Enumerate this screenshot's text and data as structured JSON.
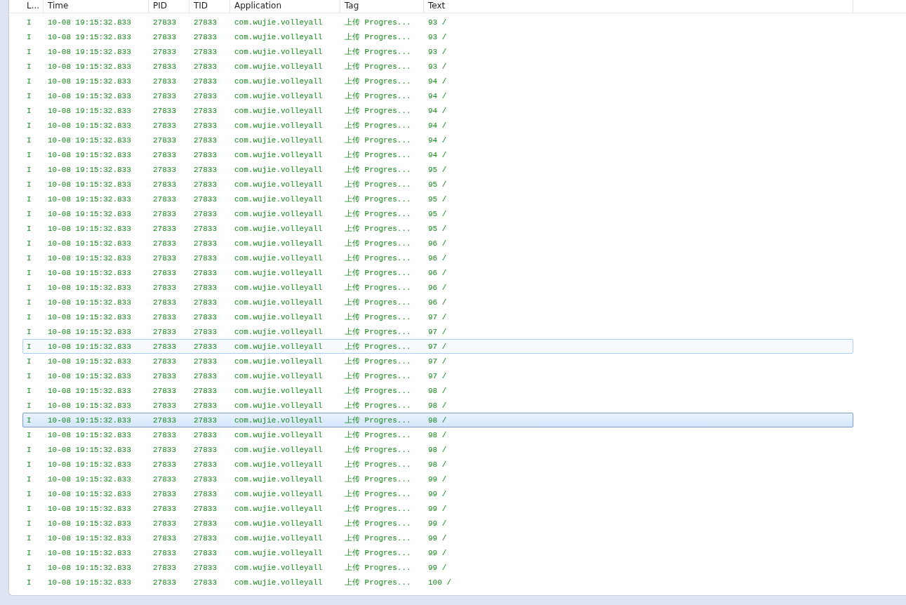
{
  "columns": [
    {
      "label": "L..."
    },
    {
      "label": "Time"
    },
    {
      "label": "PID"
    },
    {
      "label": "TID"
    },
    {
      "label": "Application"
    },
    {
      "label": "Tag"
    },
    {
      "label": "Text"
    }
  ],
  "rows": [
    {
      "cells": [
        "I",
        "10-08 19:15:32.833",
        "27833",
        "27833",
        "com.wujie.volleyall",
        "上传 Progres...",
        "93 /"
      ],
      "selected": false,
      "hovered": false
    },
    {
      "cells": [
        "I",
        "10-08 19:15:32.833",
        "27833",
        "27833",
        "com.wujie.volleyall",
        "上传 Progres...",
        "93 /"
      ],
      "selected": false,
      "hovered": false
    },
    {
      "cells": [
        "I",
        "10-08 19:15:32.833",
        "27833",
        "27833",
        "com.wujie.volleyall",
        "上传 Progres...",
        "93 /"
      ],
      "selected": false,
      "hovered": false
    },
    {
      "cells": [
        "I",
        "10-08 19:15:32.833",
        "27833",
        "27833",
        "com.wujie.volleyall",
        "上传 Progres...",
        "93 /"
      ],
      "selected": false,
      "hovered": false
    },
    {
      "cells": [
        "I",
        "10-08 19:15:32.833",
        "27833",
        "27833",
        "com.wujie.volleyall",
        "上传 Progres...",
        "94 /"
      ],
      "selected": false,
      "hovered": false
    },
    {
      "cells": [
        "I",
        "10-08 19:15:32.833",
        "27833",
        "27833",
        "com.wujie.volleyall",
        "上传 Progres...",
        "94 /"
      ],
      "selected": false,
      "hovered": false
    },
    {
      "cells": [
        "I",
        "10-08 19:15:32.833",
        "27833",
        "27833",
        "com.wujie.volleyall",
        "上传 Progres...",
        "94 /"
      ],
      "selected": false,
      "hovered": false
    },
    {
      "cells": [
        "I",
        "10-08 19:15:32.833",
        "27833",
        "27833",
        "com.wujie.volleyall",
        "上传 Progres...",
        "94 /"
      ],
      "selected": false,
      "hovered": false
    },
    {
      "cells": [
        "I",
        "10-08 19:15:32.833",
        "27833",
        "27833",
        "com.wujie.volleyall",
        "上传 Progres...",
        "94 /"
      ],
      "selected": false,
      "hovered": false
    },
    {
      "cells": [
        "I",
        "10-08 19:15:32.833",
        "27833",
        "27833",
        "com.wujie.volleyall",
        "上传 Progres...",
        "94 /"
      ],
      "selected": false,
      "hovered": false
    },
    {
      "cells": [
        "I",
        "10-08 19:15:32.833",
        "27833",
        "27833",
        "com.wujie.volleyall",
        "上传 Progres...",
        "95 /"
      ],
      "selected": false,
      "hovered": false
    },
    {
      "cells": [
        "I",
        "10-08 19:15:32.833",
        "27833",
        "27833",
        "com.wujie.volleyall",
        "上传 Progres...",
        "95 /"
      ],
      "selected": false,
      "hovered": false
    },
    {
      "cells": [
        "I",
        "10-08 19:15:32.833",
        "27833",
        "27833",
        "com.wujie.volleyall",
        "上传 Progres...",
        "95 /"
      ],
      "selected": false,
      "hovered": false
    },
    {
      "cells": [
        "I",
        "10-08 19:15:32.833",
        "27833",
        "27833",
        "com.wujie.volleyall",
        "上传 Progres...",
        "95 /"
      ],
      "selected": false,
      "hovered": false
    },
    {
      "cells": [
        "I",
        "10-08 19:15:32.833",
        "27833",
        "27833",
        "com.wujie.volleyall",
        "上传 Progres...",
        "95 /"
      ],
      "selected": false,
      "hovered": false
    },
    {
      "cells": [
        "I",
        "10-08 19:15:32.833",
        "27833",
        "27833",
        "com.wujie.volleyall",
        "上传 Progres...",
        "96 /"
      ],
      "selected": false,
      "hovered": false
    },
    {
      "cells": [
        "I",
        "10-08 19:15:32.833",
        "27833",
        "27833",
        "com.wujie.volleyall",
        "上传 Progres...",
        "96 /"
      ],
      "selected": false,
      "hovered": false
    },
    {
      "cells": [
        "I",
        "10-08 19:15:32.833",
        "27833",
        "27833",
        "com.wujie.volleyall",
        "上传 Progres...",
        "96 /"
      ],
      "selected": false,
      "hovered": false
    },
    {
      "cells": [
        "I",
        "10-08 19:15:32.833",
        "27833",
        "27833",
        "com.wujie.volleyall",
        "上传 Progres...",
        "96 /"
      ],
      "selected": false,
      "hovered": false
    },
    {
      "cells": [
        "I",
        "10-08 19:15:32.833",
        "27833",
        "27833",
        "com.wujie.volleyall",
        "上传 Progres...",
        "96 /"
      ],
      "selected": false,
      "hovered": false
    },
    {
      "cells": [
        "I",
        "10-08 19:15:32.833",
        "27833",
        "27833",
        "com.wujie.volleyall",
        "上传 Progres...",
        "97 /"
      ],
      "selected": false,
      "hovered": false
    },
    {
      "cells": [
        "I",
        "10-08 19:15:32.833",
        "27833",
        "27833",
        "com.wujie.volleyall",
        "上传 Progres...",
        "97 /"
      ],
      "selected": false,
      "hovered": false
    },
    {
      "cells": [
        "I",
        "10-08 19:15:32.833",
        "27833",
        "27833",
        "com.wujie.volleyall",
        "上传 Progres...",
        "97 /"
      ],
      "selected": false,
      "hovered": true
    },
    {
      "cells": [
        "I",
        "10-08 19:15:32.833",
        "27833",
        "27833",
        "com.wujie.volleyall",
        "上传 Progres...",
        "97 /"
      ],
      "selected": false,
      "hovered": false
    },
    {
      "cells": [
        "I",
        "10-08 19:15:32.833",
        "27833",
        "27833",
        "com.wujie.volleyall",
        "上传 Progres...",
        "97 /"
      ],
      "selected": false,
      "hovered": false
    },
    {
      "cells": [
        "I",
        "10-08 19:15:32.833",
        "27833",
        "27833",
        "com.wujie.volleyall",
        "上传 Progres...",
        "98 /"
      ],
      "selected": false,
      "hovered": false
    },
    {
      "cells": [
        "I",
        "10-08 19:15:32.833",
        "27833",
        "27833",
        "com.wujie.volleyall",
        "上传 Progres...",
        "98 /"
      ],
      "selected": false,
      "hovered": false
    },
    {
      "cells": [
        "I",
        "10-08 19:15:32.833",
        "27833",
        "27833",
        "com.wujie.volleyall",
        "上传 Progres...",
        "98 /"
      ],
      "selected": true,
      "hovered": false
    },
    {
      "cells": [
        "I",
        "10-08 19:15:32.833",
        "27833",
        "27833",
        "com.wujie.volleyall",
        "上传 Progres...",
        "98 /"
      ],
      "selected": false,
      "hovered": false
    },
    {
      "cells": [
        "I",
        "10-08 19:15:32.833",
        "27833",
        "27833",
        "com.wujie.volleyall",
        "上传 Progres...",
        "98 /"
      ],
      "selected": false,
      "hovered": false
    },
    {
      "cells": [
        "I",
        "10-08 19:15:32.833",
        "27833",
        "27833",
        "com.wujie.volleyall",
        "上传 Progres...",
        "98 /"
      ],
      "selected": false,
      "hovered": false
    },
    {
      "cells": [
        "I",
        "10-08 19:15:32.833",
        "27833",
        "27833",
        "com.wujie.volleyall",
        "上传 Progres...",
        "99 /"
      ],
      "selected": false,
      "hovered": false
    },
    {
      "cells": [
        "I",
        "10-08 19:15:32.833",
        "27833",
        "27833",
        "com.wujie.volleyall",
        "上传 Progres...",
        "99 /"
      ],
      "selected": false,
      "hovered": false
    },
    {
      "cells": [
        "I",
        "10-08 19:15:32.833",
        "27833",
        "27833",
        "com.wujie.volleyall",
        "上传 Progres...",
        "99 /"
      ],
      "selected": false,
      "hovered": false
    },
    {
      "cells": [
        "I",
        "10-08 19:15:32.833",
        "27833",
        "27833",
        "com.wujie.volleyall",
        "上传 Progres...",
        "99 /"
      ],
      "selected": false,
      "hovered": false
    },
    {
      "cells": [
        "I",
        "10-08 19:15:32.833",
        "27833",
        "27833",
        "com.wujie.volleyall",
        "上传 Progres...",
        "99 /"
      ],
      "selected": false,
      "hovered": false
    },
    {
      "cells": [
        "I",
        "10-08 19:15:32.833",
        "27833",
        "27833",
        "com.wujie.volleyall",
        "上传 Progres...",
        "99 /"
      ],
      "selected": false,
      "hovered": false
    },
    {
      "cells": [
        "I",
        "10-08 19:15:32.833",
        "27833",
        "27833",
        "com.wujie.volleyall",
        "上传 Progres...",
        "99 /"
      ],
      "selected": false,
      "hovered": false
    },
    {
      "cells": [
        "I",
        "10-08 19:15:32.833",
        "27833",
        "27833",
        "com.wujie.volleyall",
        "上传 Progres...",
        "100 /"
      ],
      "selected": false,
      "hovered": false
    }
  ]
}
